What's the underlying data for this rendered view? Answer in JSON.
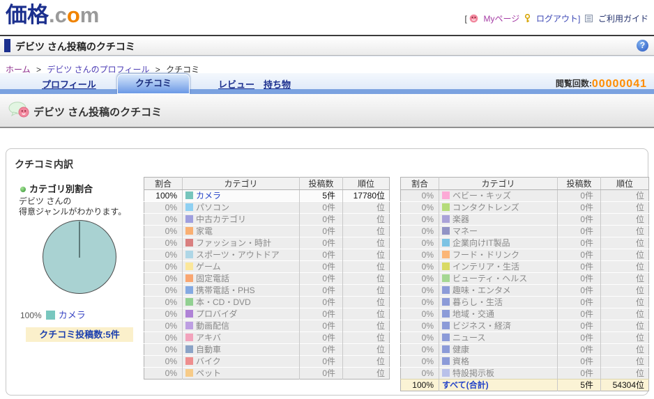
{
  "header": {
    "logo": {
      "kakaku": "価格",
      "dot_c": ".c",
      "o": "o",
      "m": "m"
    },
    "bracket_open": "[",
    "mypage_label": "Myページ",
    "logout_label": "ログアウト]",
    "guide_label": "ご利用ガイド"
  },
  "title_bar": {
    "title": "デビツ さん投稿のクチコミ",
    "help_glyph": "?"
  },
  "breadcrumb": {
    "sep": ">",
    "items": [
      {
        "label": "ホーム"
      },
      {
        "label": "デビツ さんのプロフィール"
      },
      {
        "label": "クチコミ"
      }
    ]
  },
  "tabs": {
    "items": [
      {
        "label": "プロフィール"
      },
      {
        "label": "クチコミ",
        "active": true
      },
      {
        "label": "レビュー"
      },
      {
        "label": "持ち物"
      }
    ],
    "view_count_label": "閲覧回数:",
    "view_count_value": "00000041"
  },
  "banner": {
    "title": "デビツ さん投稿のクチコミ"
  },
  "section": {
    "heading": "クチコミ内訳",
    "chart_title": "カテゴリ別割合",
    "desc_line1": "デビツ さんの",
    "desc_line2": "得意ジャンルがわかります。",
    "legend_percent": "100%",
    "legend_label": "カメラ",
    "post_count": "クチコミ投稿数:5件"
  },
  "chart_data": {
    "type": "pie",
    "title": "カテゴリ別割合",
    "labels": [
      "カメラ"
    ],
    "values": [
      100
    ],
    "unit": "%",
    "colors": [
      "#a9d2d2"
    ],
    "legend_swatch_color": "#79c7bf",
    "legend_position": "below"
  },
  "tables": {
    "columns": [
      "割合",
      "カテゴリ",
      "投稿数",
      "順位"
    ],
    "left_rows": [
      {
        "percent": "100%",
        "category": "カメラ",
        "color": "#76c5bc",
        "count": "5件",
        "rank": "17780位",
        "active": true
      },
      {
        "percent": "0%",
        "category": "パソコン",
        "color": "#8fd0f2",
        "count": "0件",
        "rank": "位"
      },
      {
        "percent": "0%",
        "category": "中古カテゴリ",
        "color": "#9f9fde",
        "count": "0件",
        "rank": "位"
      },
      {
        "percent": "0%",
        "category": "家電",
        "color": "#f9af72",
        "count": "0件",
        "rank": "位"
      },
      {
        "percent": "0%",
        "category": "ファッション・時計",
        "color": "#d98080",
        "count": "0件",
        "rank": "位"
      },
      {
        "percent": "0%",
        "category": "スポーツ・アウトドア",
        "color": "#aed6e6",
        "count": "0件",
        "rank": "位"
      },
      {
        "percent": "0%",
        "category": "ゲーム",
        "color": "#fbe79b",
        "count": "0件",
        "rank": "位"
      },
      {
        "percent": "0%",
        "category": "固定電話",
        "color": "#f9a671",
        "count": "0件",
        "rank": "位"
      },
      {
        "percent": "0%",
        "category": "携帯電話・PHS",
        "color": "#84a9e2",
        "count": "0件",
        "rank": "位"
      },
      {
        "percent": "0%",
        "category": "本・CD・DVD",
        "color": "#92d092",
        "count": "0件",
        "rank": "位"
      },
      {
        "percent": "0%",
        "category": "プロバイダ",
        "color": "#af82d6",
        "count": "0件",
        "rank": "位"
      },
      {
        "percent": "0%",
        "category": "動画配信",
        "color": "#bd9ee2",
        "count": "0件",
        "rank": "位"
      },
      {
        "percent": "0%",
        "category": "アキバ",
        "color": "#f2a3bc",
        "count": "0件",
        "rank": "位"
      },
      {
        "percent": "0%",
        "category": "自動車",
        "color": "#8ba3c6",
        "count": "0件",
        "rank": "位"
      },
      {
        "percent": "0%",
        "category": "バイク",
        "color": "#ee8e8e",
        "count": "0件",
        "rank": "位"
      },
      {
        "percent": "0%",
        "category": "ペット",
        "color": "#f7cb88",
        "count": "0件",
        "rank": "位"
      }
    ],
    "right_rows": [
      {
        "percent": "0%",
        "category": "ベビー・キッズ",
        "color": "#fcaad6",
        "count": "0件",
        "rank": "位"
      },
      {
        "percent": "0%",
        "category": "コンタクトレンズ",
        "color": "#b5dc7a",
        "count": "0件",
        "rank": "位"
      },
      {
        "percent": "0%",
        "category": "楽器",
        "color": "#aaa2d8",
        "count": "0件",
        "rank": "位"
      },
      {
        "percent": "0%",
        "category": "マネー",
        "color": "#9193c5",
        "count": "0件",
        "rank": "位"
      },
      {
        "percent": "0%",
        "category": "企業向けIT製品",
        "color": "#7cc3e4",
        "count": "0件",
        "rank": "位"
      },
      {
        "percent": "0%",
        "category": "フード・ドリンク",
        "color": "#fbb677",
        "count": "0件",
        "rank": "位"
      },
      {
        "percent": "0%",
        "category": "インテリア・生活",
        "color": "#d9da63",
        "count": "0件",
        "rank": "位"
      },
      {
        "percent": "0%",
        "category": "ビューティ・ヘルス",
        "color": "#a5d793",
        "count": "0件",
        "rank": "位"
      },
      {
        "percent": "0%",
        "category": "趣味・エンタメ",
        "color": "#8c9bd8",
        "count": "0件",
        "rank": "位"
      },
      {
        "percent": "0%",
        "category": "暮らし・生活",
        "color": "#8c9bd8",
        "count": "0件",
        "rank": "位"
      },
      {
        "percent": "0%",
        "category": "地域・交通",
        "color": "#8c9bd8",
        "count": "0件",
        "rank": "位"
      },
      {
        "percent": "0%",
        "category": "ビジネス・経済",
        "color": "#8c9bd8",
        "count": "0件",
        "rank": "位"
      },
      {
        "percent": "0%",
        "category": "ニュース",
        "color": "#8c9bd8",
        "count": "0件",
        "rank": "位"
      },
      {
        "percent": "0%",
        "category": "健康",
        "color": "#8c9bd8",
        "count": "0件",
        "rank": "位"
      },
      {
        "percent": "0%",
        "category": "資格",
        "color": "#8c9bd8",
        "count": "0件",
        "rank": "位"
      },
      {
        "percent": "0%",
        "category": "特設掲示板",
        "color": "#b9c1e9",
        "count": "0件",
        "rank": "位"
      }
    ],
    "right_total": {
      "percent": "100%",
      "category": "すべて(合計)",
      "count": "5件",
      "rank": "54304位"
    }
  },
  "colors": {
    "accent_orange": "#ff8c00",
    "tab_strip_blue": "#7ba2e0",
    "pie_fill": "#a9d2d2",
    "total_row_bg": "#fbf3d5",
    "link_blue": "#2443c8",
    "logo_blue": "#1b2f8e",
    "logo_orange": "#f08300"
  }
}
